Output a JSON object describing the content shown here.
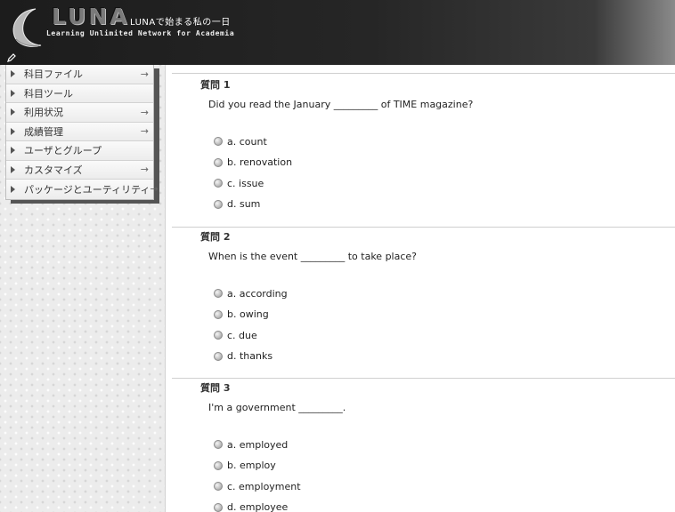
{
  "header": {
    "brand": "LUNA",
    "tagline": "LUNAで始まる私の一日",
    "subtitle": "Learning Unlimited Network for Academia"
  },
  "sidebar": {
    "items": [
      {
        "label": "科目ファイル",
        "has_arrow": true
      },
      {
        "label": "科目ツール",
        "has_arrow": false
      },
      {
        "label": "利用状況",
        "has_arrow": true
      },
      {
        "label": "成績管理",
        "has_arrow": true
      },
      {
        "label": "ユーザとグループ",
        "has_arrow": false
      },
      {
        "label": "カスタマイズ",
        "has_arrow": true
      },
      {
        "label": "パッケージとユーティリティ",
        "has_arrow": true
      }
    ],
    "arrow_glyph": "→"
  },
  "questions": [
    {
      "title": "質問 1",
      "text": "Did you read the January _________ of TIME magazine?",
      "options": [
        "a. count",
        "b. renovation",
        "c. issue",
        "d. sum"
      ]
    },
    {
      "title": "質問 2",
      "text": "When is the event _________ to take place?",
      "options": [
        "a. according",
        "b. owing",
        "c. due",
        "d. thanks"
      ]
    },
    {
      "title": "質問 3",
      "text": "I'm a government _________.",
      "options": [
        "a. employed",
        "b. employ",
        "c. employment",
        "d. employee"
      ]
    }
  ],
  "colors": {
    "header_bg": "#1c1c1c",
    "sidebar_bg": "#ececec",
    "divider": "#cfcfcf"
  }
}
